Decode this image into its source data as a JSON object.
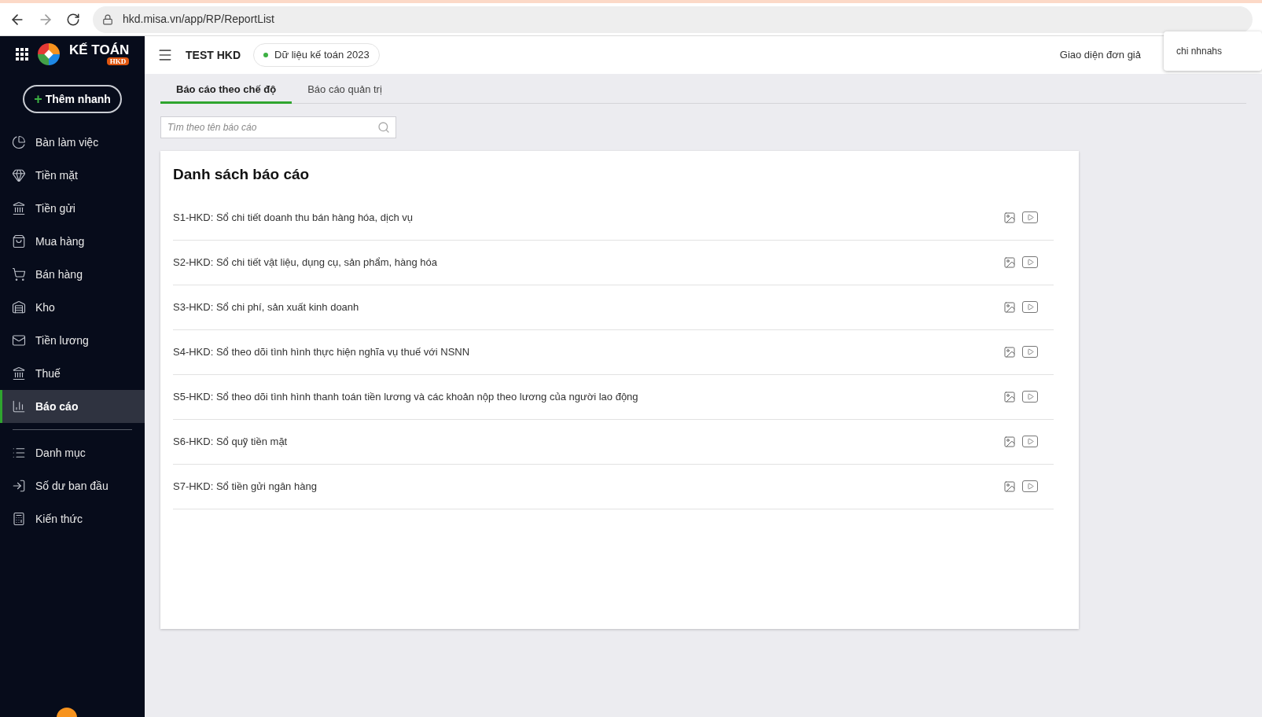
{
  "browser": {
    "url": "hkd.misa.vn/app/RP/ReportList"
  },
  "logo": {
    "title": "KẾ TOÁN",
    "badge": "HKD"
  },
  "quick_add": {
    "label": "Thêm nhanh",
    "icon": "+"
  },
  "sidebar": {
    "items": [
      {
        "label": "Bàn làm việc",
        "selected": false
      },
      {
        "label": "Tiền mặt",
        "selected": false
      },
      {
        "label": "Tiền gửi",
        "selected": false
      },
      {
        "label": "Mua hàng",
        "selected": false
      },
      {
        "label": "Bán hàng",
        "selected": false
      },
      {
        "label": "Kho",
        "selected": false
      },
      {
        "label": "Tiền lương",
        "selected": false
      },
      {
        "label": "Thuế",
        "selected": false
      },
      {
        "label": "Báo cáo",
        "selected": true
      }
    ],
    "bottom_items": [
      {
        "label": "Danh mục",
        "selected": false
      },
      {
        "label": "Số dư ban đầu",
        "selected": false
      },
      {
        "label": "Kiến thức",
        "selected": false
      }
    ]
  },
  "header": {
    "company": "TEST HKD",
    "dataset": "Dữ liệu kế toán 2023",
    "view_mode": "Giao diện đơn giả"
  },
  "popup": {
    "text": "chi nhnahs"
  },
  "tabs": [
    {
      "label": "Báo cáo theo chế độ",
      "selected": true
    },
    {
      "label": "Báo cáo quản trị",
      "selected": false
    }
  ],
  "search": {
    "placeholder": "Tìm theo tên báo cáo"
  },
  "report_list": {
    "title": "Danh sách báo cáo",
    "rows": [
      "S1-HKD: Sổ chi tiết doanh thu bán hàng hóa, dịch vụ",
      "S2-HKD: Sổ chi tiết vật liệu, dụng cụ, sản phẩm, hàng hóa",
      "S3-HKD: Sổ chi phí, sản xuất kinh doanh",
      "S4-HKD: Sổ theo dõi tình hình thực hiện nghĩa vụ thuế với NSNN",
      "S5-HKD: Sổ theo dõi tình hình thanh toán tiền lương và các khoản nộp theo lương của người lao động",
      "S6-HKD: Sổ quỹ tiền mặt",
      "S7-HKD: Sổ tiền gửi ngân hàng"
    ]
  }
}
